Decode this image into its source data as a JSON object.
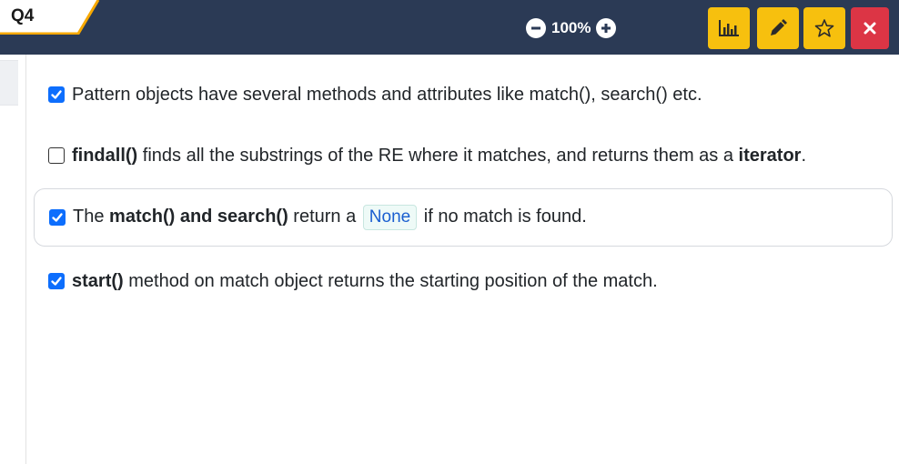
{
  "header": {
    "question_tab": "Q4",
    "zoom_level": "100%",
    "buttons": [
      "stats",
      "edit",
      "favorite",
      "close"
    ],
    "colors": {
      "bar": "#2b3a55",
      "accent": "#f7c00e",
      "close": "#dc3545",
      "checkbox": "#0d6efd"
    }
  },
  "options": [
    {
      "checked": true,
      "t1": "Pattern objects have several methods and attributes like match(), search() etc."
    },
    {
      "checked": false,
      "b1": "findall()",
      "t1": " finds all the substrings of the RE where it matches, and returns them as a ",
      "b2": "iterator",
      "t2": "."
    },
    {
      "checked": true,
      "t1": "The ",
      "b1": "match() and search()",
      "t2": " return a ",
      "code": "None",
      "t3": " if no match is found."
    },
    {
      "checked": true,
      "b1": "start()",
      "t1": " method on match object returns the starting position of the match."
    }
  ]
}
